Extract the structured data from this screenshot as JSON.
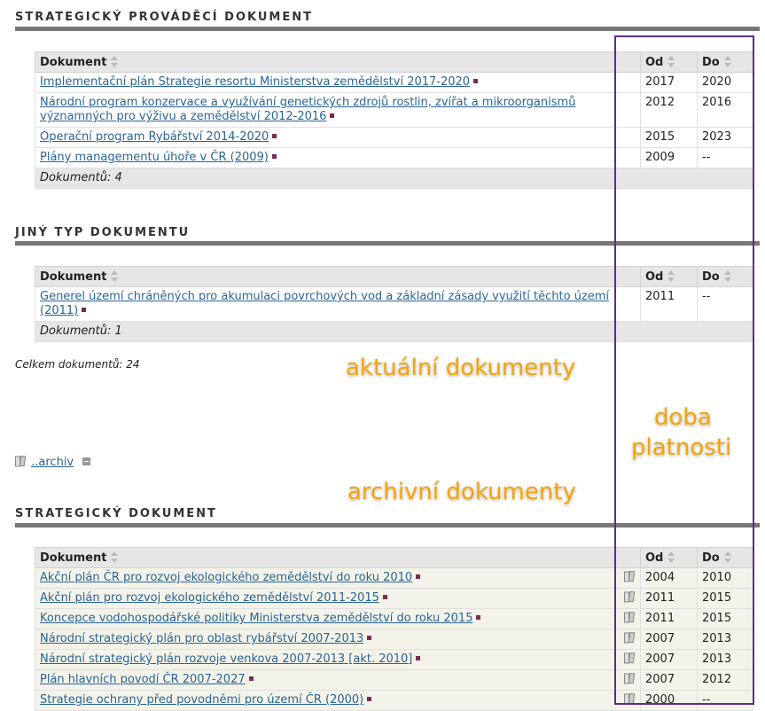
{
  "sections": {
    "s1": {
      "title": "STRATEGICKÝ PROVÁDĚCÍ DOKUMENT",
      "header": {
        "doc": "Dokument",
        "from": "Od",
        "to": "Do"
      },
      "rows": [
        {
          "title_l1": "Implementační plán Strategie resortu Ministerstva zemědělství 2017-2020",
          "title_l2": "",
          "from": "2017",
          "to": "2020"
        },
        {
          "title_l1": "Národní program konzervace a využívání genetických zdrojů rostlin, zvířat a mikroorganismů",
          "title_l2": "významných pro výživu a zemědělství 2012-2016",
          "from": "2012",
          "to": "2016"
        },
        {
          "title_l1": "Operační program Rybářství 2014-2020",
          "title_l2": "",
          "from": "2015",
          "to": "2023"
        },
        {
          "title_l1": "Plány managementu úhoře v ČR (2009)",
          "title_l2": "",
          "from": "2009",
          "to": "--"
        }
      ],
      "footer": "Dokumentů: 4"
    },
    "s2": {
      "title": "JINÝ TYP DOKUMENTU",
      "header": {
        "doc": "Dokument",
        "from": "Od",
        "to": "Do"
      },
      "rows": [
        {
          "title_l1": "Generel území chráněných pro akumulaci povrchových vod a základní zásady využití těchto území",
          "title_l2": "(2011)",
          "from": "2011",
          "to": "--"
        }
      ],
      "footer": "Dokumentů: 1"
    },
    "s3": {
      "title": "STRATEGICKÝ DOKUMENT",
      "header": {
        "doc": "Dokument",
        "from": "Od",
        "to": "Do"
      },
      "rows": [
        {
          "title": "Akční plán ČR pro rozvoj ekologického zemědělství do roku 2010",
          "from": "2004",
          "to": "2010"
        },
        {
          "title": "Akční plán pro rozvoj ekologického zemědělství 2011-2015",
          "from": "2011",
          "to": "2015"
        },
        {
          "title": "Koncepce vodohospodářské politiky Ministerstva zemědělství do roku 2015",
          "from": "2011",
          "to": "2015"
        },
        {
          "title": "Národní strategický plán pro oblast rybářství 2007-2013",
          "from": "2007",
          "to": "2013"
        },
        {
          "title": "Národní strategický plán rozvoje venkova 2007-2013 [akt. 2010]",
          "from": "2007",
          "to": "2013"
        },
        {
          "title": "Plán hlavních povodí ČR 2007-2027",
          "from": "2007",
          "to": "2012"
        },
        {
          "title": "Strategie ochrany před povodněmi pro území ČR (2000)",
          "from": "2000",
          "to": "--"
        }
      ]
    }
  },
  "total": "Celkem dokumentů: 24",
  "archive_link": "..archiv",
  "annotations": {
    "current": "aktuální dokumenty",
    "validity_l1": "doba",
    "validity_l2": "platnosti",
    "archived": "archivní dokumenty"
  },
  "icons": {
    "sort": "sort-icon",
    "archive": "archive-icon",
    "marker": "square-marker-icon",
    "toggle": "collapse-toggle-icon"
  },
  "colors": {
    "link": "#2a6496",
    "annotation": "#f5a300",
    "highlight_box": "#5b2d8e",
    "marker": "#7a2b52"
  }
}
